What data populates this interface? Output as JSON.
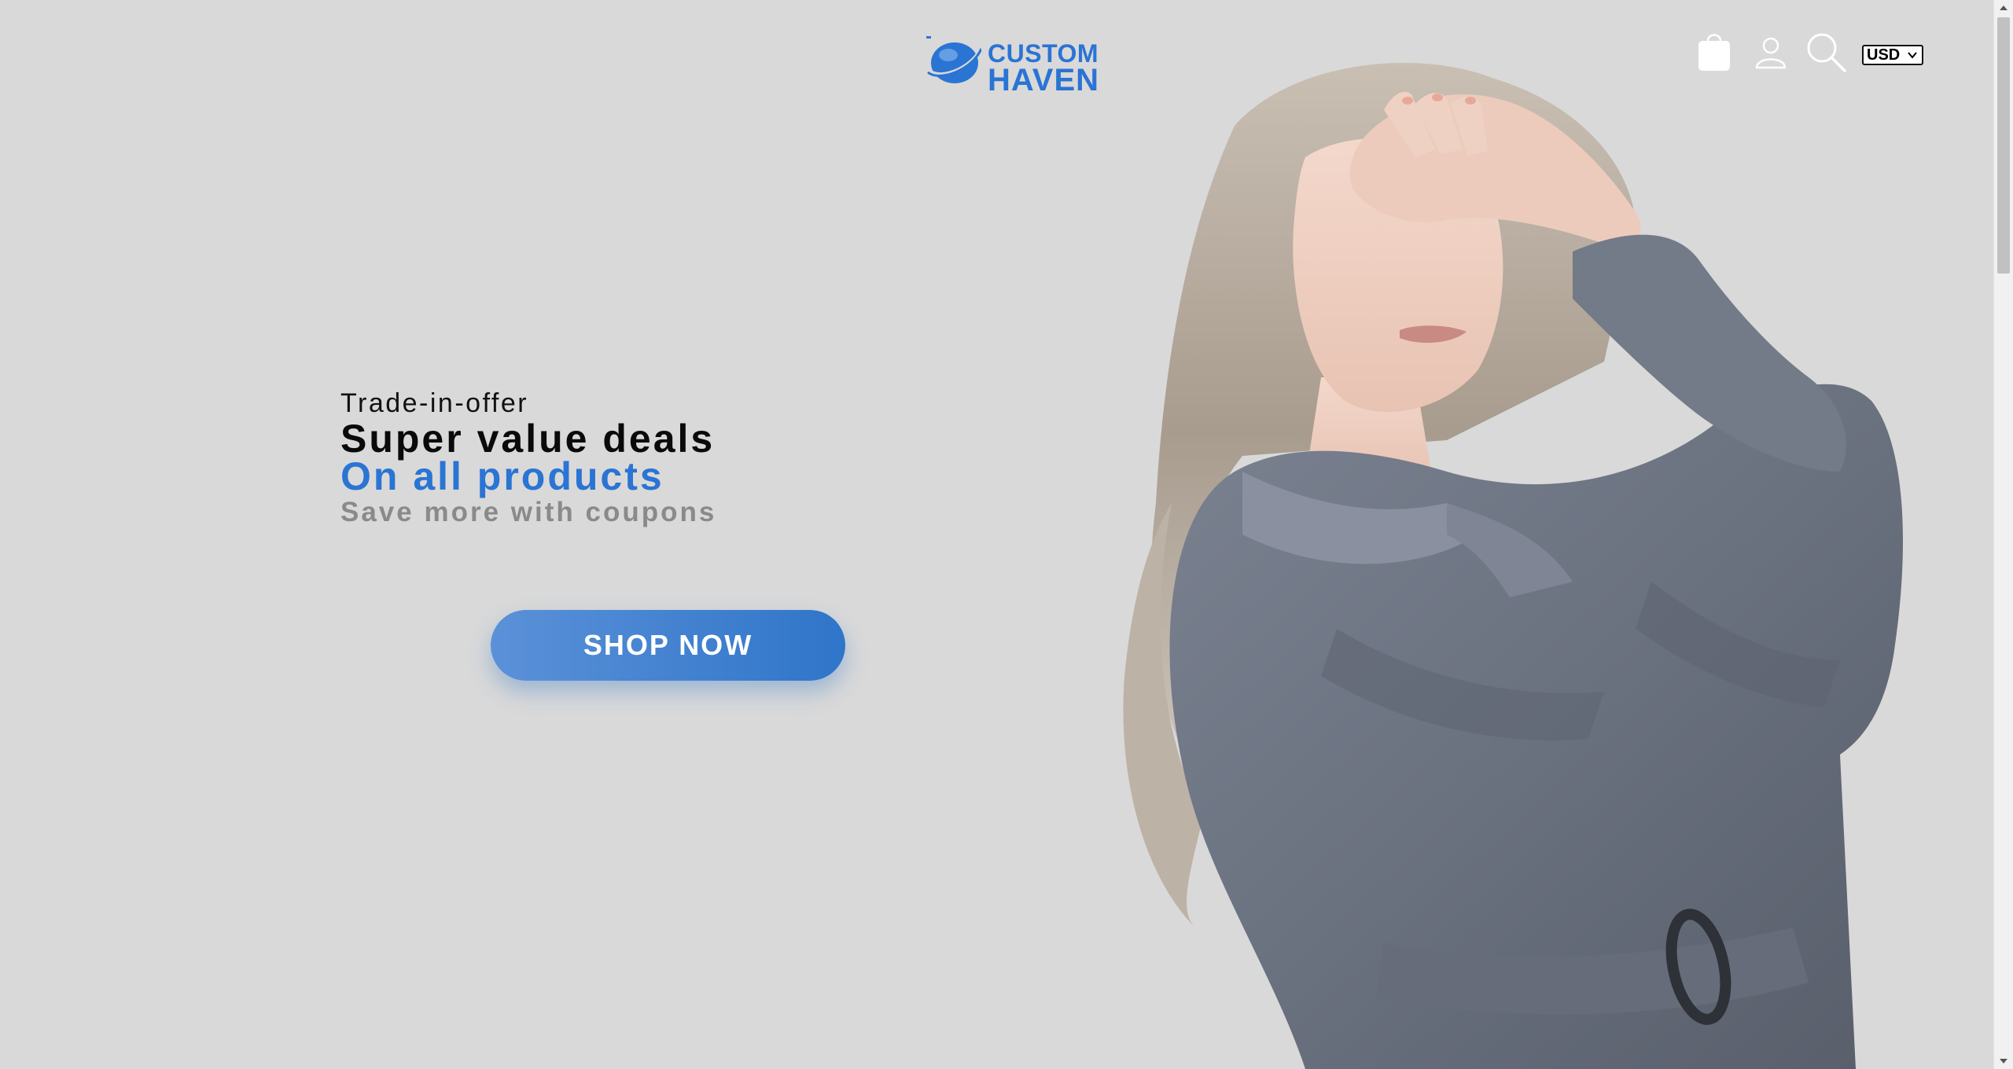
{
  "header": {
    "logo": {
      "line1": "CUSTOM",
      "line2": "HAVEN"
    },
    "icons": [
      "shopping-bag-icon",
      "user-icon",
      "search-icon"
    ],
    "currency": {
      "selected": "USD"
    }
  },
  "hero": {
    "kicker": "Trade-in-offer",
    "title": "Super value deals",
    "title_highlight": "On all products",
    "subtitle": "Save more with coupons",
    "cta_label": "SHOP NOW"
  },
  "colors": {
    "background": "#d9d9d9",
    "brand_blue": "#2a74d4",
    "subtitle_gray": "#8a8a8a",
    "coat_gray": "#6f7683"
  }
}
